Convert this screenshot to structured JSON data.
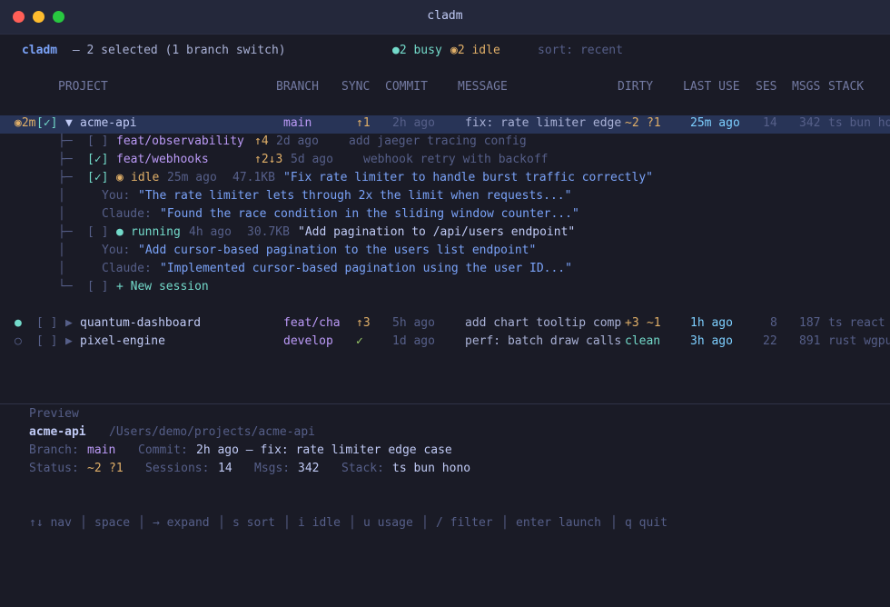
{
  "window": {
    "title": "cladm"
  },
  "header": {
    "app": "cladm",
    "selected": " — 2 selected (1 branch switch)",
    "busy": "●2 busy",
    "idle": "◉2 idle",
    "sort": "sort: recent"
  },
  "columns": {
    "project": "PROJECT",
    "branch": "BRANCH",
    "sync": "SYNC",
    "commit": "COMMIT",
    "message": "MESSAGE",
    "dirty": "DIRTY",
    "last_use": "LAST USE",
    "ses": "SES",
    "msgs": "MSGS",
    "stack": "STACK"
  },
  "projects": [
    {
      "status": "◉2m",
      "check": "[✓]",
      "caret": "▼",
      "name": "acme-api",
      "branch": "main",
      "sync": "↑1",
      "commit": "2h ago",
      "message": "fix: rate limiter edge",
      "dirty_a": "~2",
      "dirty_b": "?1",
      "last_use": "25m ago",
      "ses": "14",
      "msgs": "342",
      "stack": "ts bun ho"
    },
    {
      "status": "●",
      "check": "[ ]",
      "caret": "▶",
      "name": "quantum-dashboard",
      "branch": "feat/cha",
      "sync": "↑3",
      "commit": "5h ago",
      "message": "add chart tooltip comp",
      "dirty_a": "+3",
      "dirty_b": "~1",
      "last_use": "1h ago",
      "ses": "8",
      "msgs": "187",
      "stack": "ts react"
    },
    {
      "status": "○",
      "check": "[ ]",
      "caret": "▶",
      "name": "pixel-engine",
      "branch": "develop",
      "sync": "✓",
      "commit": "1d ago",
      "message": "perf: batch draw calls",
      "dirty_a": "clean",
      "dirty_b": "",
      "last_use": "3h ago",
      "ses": "22",
      "msgs": "891",
      "stack": "rust wgpu"
    }
  ],
  "tree": {
    "branches": [
      {
        "prefix": "├─",
        "check": "[ ]",
        "name": "feat/observability",
        "sync": "↑4",
        "age": "2d ago",
        "message": "add jaeger tracing config"
      },
      {
        "prefix": "├─",
        "check": "[✓]",
        "name": "feat/webhooks",
        "sync": "↑2↓3",
        "age": "5d ago",
        "message": "webhook retry with backoff"
      }
    ],
    "sessions": [
      {
        "prefix": "├─",
        "check": "[✓]",
        "icon": "◉",
        "state": "idle",
        "age": "25m ago",
        "size": "47.1KB",
        "title": "\"Fix rate limiter to handle burst traffic correctly\"",
        "you_label": "You:",
        "you": "\"The rate limiter lets through 2x the limit when requests...\"",
        "claude_label": "Claude:",
        "claude": "\"Found the race condition in the sliding window counter...\""
      },
      {
        "prefix": "├─",
        "check": "[ ]",
        "icon": "●",
        "state": "running",
        "age": "4h ago",
        "size": "30.7KB",
        "title": "\"Add pagination to /api/users endpoint\"",
        "you_label": "You:",
        "you": "\"Add cursor-based pagination to the users list endpoint\"",
        "claude_label": "Claude:",
        "claude": "\"Implemented cursor-based pagination using the user ID...\""
      }
    ],
    "new_session": {
      "prefix": "└─",
      "check": "[ ]",
      "label": "+ New session"
    }
  },
  "preview": {
    "heading": "Preview",
    "name": "acme-api",
    "path": "/Users/demo/projects/acme-api",
    "branch_label": "Branch:",
    "branch": "main",
    "commit_label": "Commit:",
    "commit": "2h ago — fix: rate limiter edge case",
    "status_label": "Status:",
    "status_a": "~2",
    "status_b": "?1",
    "sessions_label": "Sessions:",
    "sessions": "14",
    "msgs_label": "Msgs:",
    "msgs": "342",
    "stack_label": "Stack:",
    "stack": "ts bun hono"
  },
  "help": {
    "nav": "↑↓ nav",
    "space": "space",
    "expand": "→ expand",
    "sort": "s sort",
    "idle": "i idle",
    "usage": "u usage",
    "filter": "/ filter",
    "launch": "enter launch",
    "quit": "q quit",
    "sep": "│"
  }
}
